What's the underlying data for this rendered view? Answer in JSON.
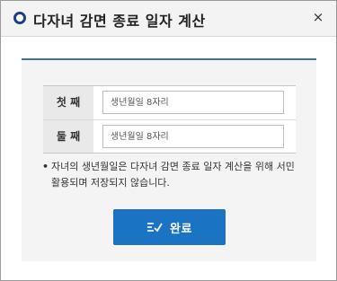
{
  "dialog": {
    "title": "다자녀 감면 종료 일자 계산",
    "close_symbol": "×"
  },
  "form": {
    "rows": [
      {
        "label": "첫 째",
        "placeholder": "생년월일 8자리"
      },
      {
        "label": "둘 째",
        "placeholder": "생년월일 8자리"
      }
    ]
  },
  "notice": {
    "bullet": "•",
    "text": "자녀의 생년월일은 다자녀 감면 종료 일자 계산을 위해 서민 활용되며 저장되지 않습니다."
  },
  "actions": {
    "confirm_label": "완료",
    "confirm_icon": "checklist-icon"
  },
  "colors": {
    "accent": "#1b73c4",
    "title_icon": "#1f3f86",
    "panel_border": "#3b6fae"
  }
}
